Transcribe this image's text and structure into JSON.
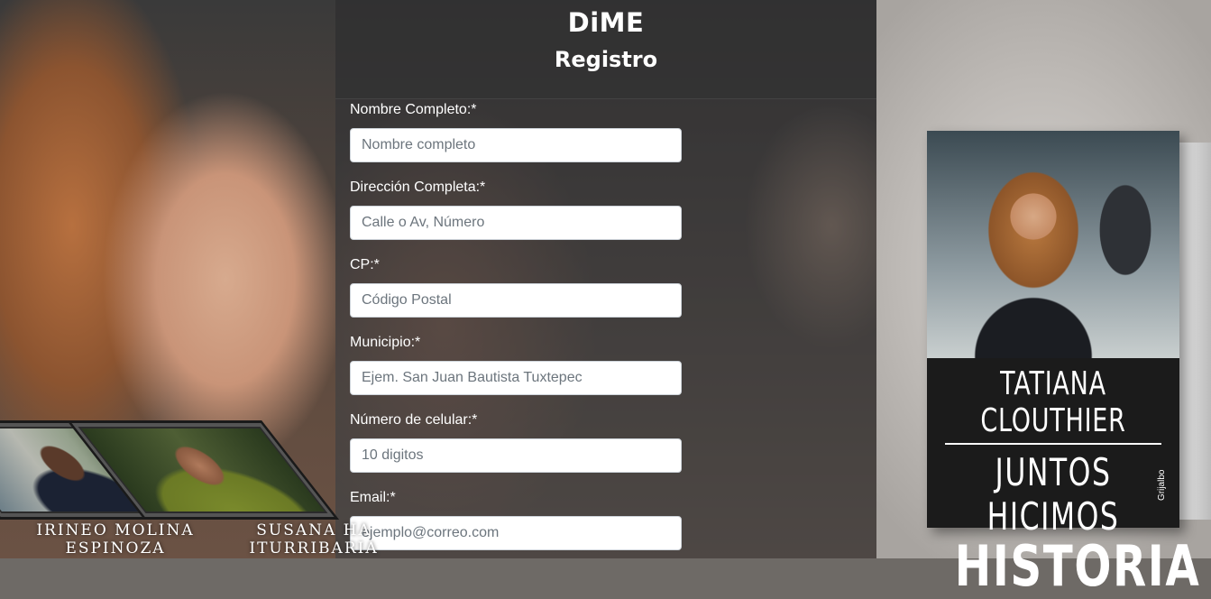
{
  "header": {
    "brand": "DiME",
    "title": "Registro"
  },
  "form": {
    "fields": [
      {
        "label": "Nombre Completo:*",
        "placeholder": "Nombre completo",
        "value": ""
      },
      {
        "label": "Dirección Completa:*",
        "placeholder": "Calle o Av, Número",
        "value": ""
      },
      {
        "label": "CP:*",
        "placeholder": "Código Postal",
        "value": ""
      },
      {
        "label": "Municipio:*",
        "placeholder": "Ejem. San Juan Bautista Tuxtepec",
        "value": ""
      },
      {
        "label": "Número de celular:*",
        "placeholder": "10 digitos",
        "value": ""
      },
      {
        "label": "Email:*",
        "placeholder": "ejemplo@correo.com",
        "value": ""
      }
    ]
  },
  "profiles": [
    {
      "name_line1": "IRINEO  MOLINA",
      "name_line2": "ESPINOZA"
    },
    {
      "name_line1": "SUSANA HA",
      "name_line2": "ITURRIBARIA"
    }
  ],
  "book": {
    "author": "TATIANA CLOUTHIER",
    "title_line1": "JUNTOS HICIMOS",
    "title_line2": "HISTORIA",
    "publisher": "Grijalbo"
  },
  "colors": {
    "input_border": "#ced4da",
    "label_text": "#ffffff",
    "header_overlay": "#323232"
  }
}
